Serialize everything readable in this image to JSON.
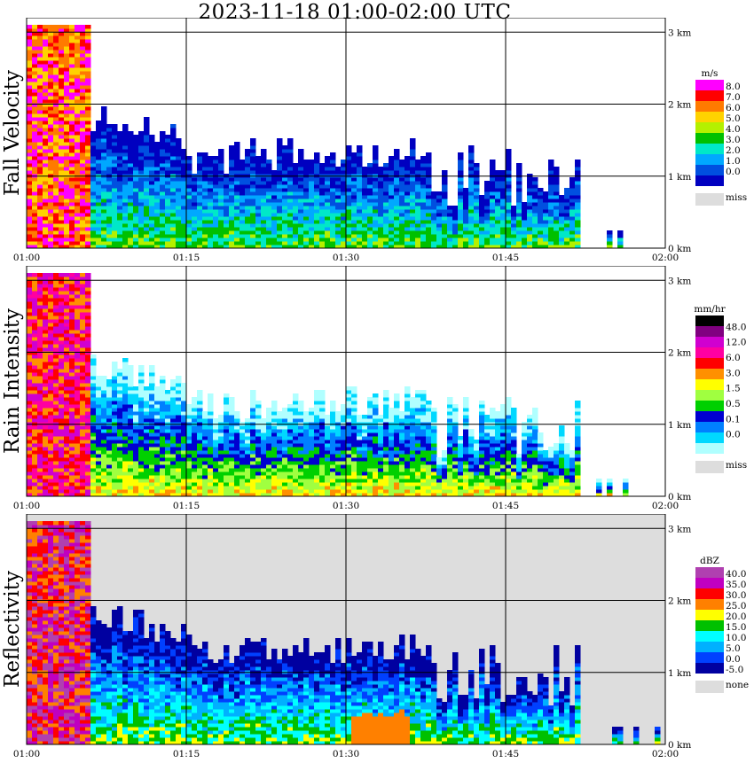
{
  "title": "2023-11-18   01:00-02:00 UTC",
  "chart_data": [
    {
      "type": "heatmap",
      "ylabel": "Fall Velocity",
      "units": "m/s",
      "x_ticks": [
        "01:00",
        "01:15",
        "01:30",
        "01:45",
        "02:00"
      ],
      "y_ticks": [
        "0 km",
        "1 km",
        "2 km",
        "3 km"
      ],
      "ylim_km": [
        0,
        3.2
      ],
      "grid": true,
      "legend": {
        "labels": [
          "8.0",
          "7.0",
          "6.0",
          "5.0",
          "4.0",
          "3.0",
          "2.0",
          "1.0",
          "0.0"
        ],
        "colors": [
          "#ff00ff",
          "#ff0000",
          "#ff7a00",
          "#ffd200",
          "#b4f000",
          "#00c000",
          "#00e8c8",
          "#00a8ff",
          "#0050e0",
          "#0000c0"
        ],
        "missing_label": "miss",
        "missing_color": "#dddddd"
      }
    },
    {
      "type": "heatmap",
      "ylabel": "Rain Intensity",
      "units": "mm/hr",
      "x_ticks": [
        "01:00",
        "01:15",
        "01:30",
        "01:45",
        "02:00"
      ],
      "y_ticks": [
        "0 km",
        "1 km",
        "2 km",
        "3 km"
      ],
      "ylim_km": [
        0,
        3.2
      ],
      "grid": true,
      "legend": {
        "labels": [
          "48.0",
          "12.0",
          "6.0",
          "3.0",
          "1.5",
          "0.5",
          "0.1",
          "0.0"
        ],
        "colors": [
          "#000000",
          "#800080",
          "#d000d0",
          "#ff00a0",
          "#ff0000",
          "#ff9000",
          "#ffff00",
          "#a0ff40",
          "#00d000",
          "#0000d0",
          "#0080ff",
          "#00d8ff",
          "#b0ffff"
        ],
        "missing_label": "miss",
        "missing_color": "#dddddd"
      }
    },
    {
      "type": "heatmap",
      "ylabel": "Reflectivity",
      "units": "dBZ",
      "x_ticks": [
        "01:00",
        "01:15",
        "01:30",
        "01:45",
        "02:00"
      ],
      "y_ticks": [
        "0 km",
        "1 km",
        "2 km",
        "3 km"
      ],
      "ylim_km": [
        0,
        3.2
      ],
      "grid": true,
      "legend": {
        "labels": [
          "40.0",
          "35.0",
          "30.0",
          "25.0",
          "20.0",
          "15.0",
          "10.0",
          "5.0",
          "0.0",
          "-5.0"
        ],
        "colors": [
          "#b040b0",
          "#c000c0",
          "#ff0000",
          "#ff8000",
          "#ffff00",
          "#00c000",
          "#00ffff",
          "#00b0ff",
          "#0040ff",
          "#0000a0"
        ],
        "missing_label": "none",
        "missing_color": "#dddddd"
      }
    }
  ]
}
